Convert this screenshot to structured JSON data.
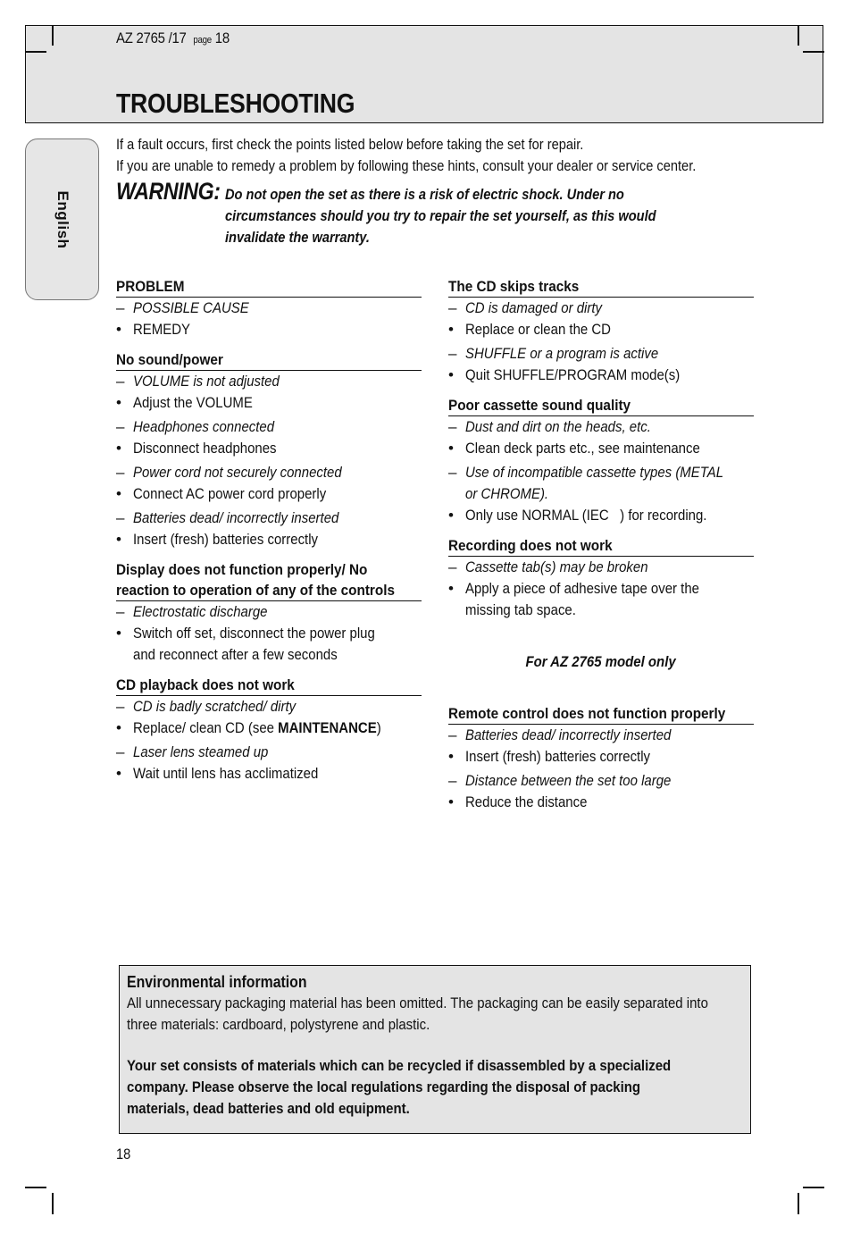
{
  "header": {
    "doc_model": "AZ 2765 /17",
    "page_word": "page",
    "page_ref": "18",
    "title": "TROUBLESHOOTING"
  },
  "side_tab": {
    "language": "English"
  },
  "intro": {
    "line1": "If a fault occurs, first check the points listed below before taking the set for repair.",
    "line2": "If you are unable to remedy a problem by following these hints, consult your dealer or service center."
  },
  "warning": {
    "label": "WARNING:",
    "lines": [
      "Do not open the set as there is a risk of electric shock. Under no",
      "circumstances should you try to repair the set yourself, as this would",
      "invalidate the warranty."
    ]
  },
  "markers": {
    "cause": "–",
    "remedy": "•"
  },
  "left_column": [
    {
      "title": "PROBLEM",
      "items": [
        {
          "cause": "POSSIBLE CAUSE",
          "remedy": "REMEDY"
        }
      ]
    },
    {
      "title": "No sound/power",
      "items": [
        {
          "cause": "VOLUME is not adjusted",
          "remedy": "Adjust the VOLUME"
        },
        {
          "cause": "Headphones connected",
          "remedy": "Disconnect headphones"
        },
        {
          "cause": "Power cord not securely connected",
          "remedy": "Connect AC power cord properly"
        },
        {
          "cause": "Batteries dead/ incorrectly inserted",
          "remedy": "Insert (fresh) batteries correctly"
        }
      ]
    },
    {
      "title_lines": [
        "Display does not function properly/ No",
        "reaction to operation of any of the controls"
      ],
      "items": [
        {
          "cause": "Electrostatic discharge",
          "remedy_lines": [
            "Switch off set, disconnect the power plug",
            "and reconnect after a few seconds"
          ]
        }
      ]
    },
    {
      "title": "CD playback does not work",
      "items": [
        {
          "cause": "CD is badly scratched/ dirty",
          "remedy_prefix": "Replace/ clean CD (see ",
          "remedy_bold": "MAINTENANCE",
          "remedy_suffix": ")"
        },
        {
          "cause": "Laser lens steamed up",
          "remedy": "Wait until lens has acclimatized"
        }
      ]
    }
  ],
  "right_column": [
    {
      "title": "The CD skips tracks",
      "items": [
        {
          "cause": "CD is damaged or dirty",
          "remedy": "Replace or clean the CD"
        },
        {
          "cause": "SHUFFLE or a program is active",
          "remedy": "Quit SHUFFLE/PROGRAM mode(s)"
        }
      ]
    },
    {
      "title": "Poor cassette sound quality",
      "items": [
        {
          "cause": "Dust and dirt on the heads, etc.",
          "remedy": "Clean deck parts etc., see maintenance"
        },
        {
          "cause_lines": [
            "Use of incompatible cassette types (METAL",
            "or CHROME)."
          ],
          "remedy": "Only use NORMAL (IEC   ) for recording."
        }
      ]
    },
    {
      "title": "Recording does not work",
      "items": [
        {
          "cause": "Cassette tab(s) may be broken",
          "remedy_lines": [
            "Apply a piece of adhesive tape over the",
            "missing tab space."
          ]
        }
      ]
    },
    {
      "model_note": "For AZ 2765 model only"
    },
    {
      "title": "Remote control does not function properly",
      "items": [
        {
          "cause": "Batteries dead/ incorrectly inserted",
          "remedy": "Insert (fresh) batteries correctly"
        },
        {
          "cause": "Distance between the set too large",
          "remedy": "Reduce the distance"
        }
      ]
    }
  ],
  "environment": {
    "title": "Environmental information",
    "body_lines": [
      "All unnecessary packaging material has been omitted. The packaging can be easily separated into",
      "three materials: cardboard, polystyrene and plastic."
    ],
    "bold_lines": [
      "Your set consists of materials which can be recycled if disassembled by a specialized",
      "company. Please observe the local regulations regarding the disposal of packing",
      "materials, dead batteries and old equipment."
    ]
  },
  "footer": {
    "page_number": "18"
  }
}
